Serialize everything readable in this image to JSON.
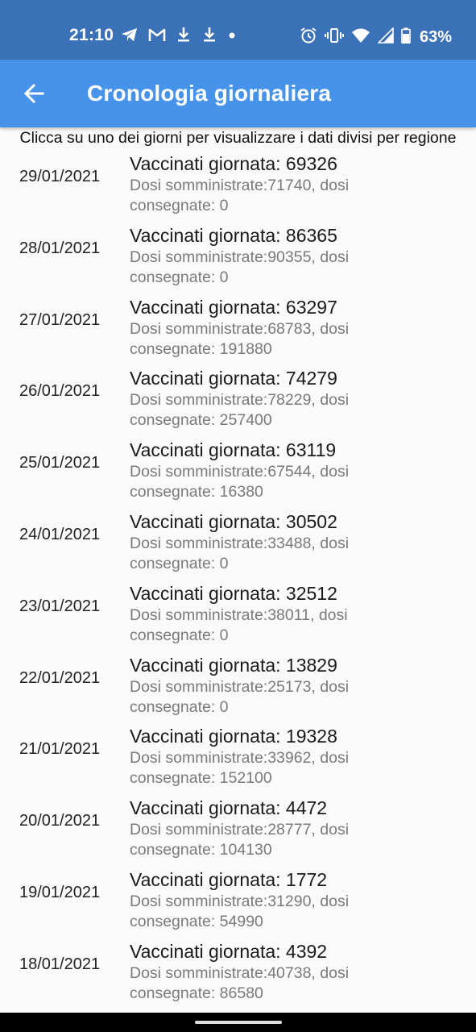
{
  "status_bar": {
    "time": "21:10",
    "battery": "63%",
    "left_icons": [
      "telegram-icon",
      "gmail-icon",
      "download-icon",
      "download-icon",
      "dot-icon"
    ],
    "right_icons": [
      "alarm-icon",
      "vibrate-icon",
      "wifi-icon",
      "signal-icon",
      "battery-icon"
    ]
  },
  "app_bar": {
    "title": "Cronologia giornaliera",
    "back_icon": "arrow-back-icon",
    "color": "#4793e9"
  },
  "subtitle": "Clicca su uno dei giorni per visualizzare i dati divisi per regione",
  "days": [
    {
      "date": "29/01/2021",
      "title": "Vaccinati giornata: 69326",
      "subtitle": "Dosi somministrate:71740, dosi consegnate: 0"
    },
    {
      "date": "28/01/2021",
      "title": "Vaccinati giornata: 86365",
      "subtitle": "Dosi somministrate:90355, dosi consegnate: 0"
    },
    {
      "date": "27/01/2021",
      "title": "Vaccinati giornata: 63297",
      "subtitle": "Dosi somministrate:68783, dosi consegnate: 191880"
    },
    {
      "date": "26/01/2021",
      "title": "Vaccinati giornata: 74279",
      "subtitle": "Dosi somministrate:78229, dosi consegnate: 257400"
    },
    {
      "date": "25/01/2021",
      "title": "Vaccinati giornata: 63119",
      "subtitle": "Dosi somministrate:67544, dosi consegnate: 16380"
    },
    {
      "date": "24/01/2021",
      "title": "Vaccinati giornata: 30502",
      "subtitle": "Dosi somministrate:33488, dosi consegnate: 0"
    },
    {
      "date": "23/01/2021",
      "title": "Vaccinati giornata: 32512",
      "subtitle": "Dosi somministrate:38011, dosi consegnate: 0"
    },
    {
      "date": "22/01/2021",
      "title": "Vaccinati giornata: 13829",
      "subtitle": "Dosi somministrate:25173, dosi consegnate: 0"
    },
    {
      "date": "21/01/2021",
      "title": "Vaccinati giornata: 19328",
      "subtitle": "Dosi somministrate:33962, dosi consegnate: 152100"
    },
    {
      "date": "20/01/2021",
      "title": "Vaccinati giornata: 4472",
      "subtitle": "Dosi somministrate:28777, dosi consegnate: 104130"
    },
    {
      "date": "19/01/2021",
      "title": "Vaccinati giornata: 1772",
      "subtitle": "Dosi somministrate:31290, dosi consegnate: 54990"
    },
    {
      "date": "18/01/2021",
      "title": "Vaccinati giornata: 4392",
      "subtitle": "Dosi somministrate:40738, dosi consegnate: 86580"
    }
  ]
}
